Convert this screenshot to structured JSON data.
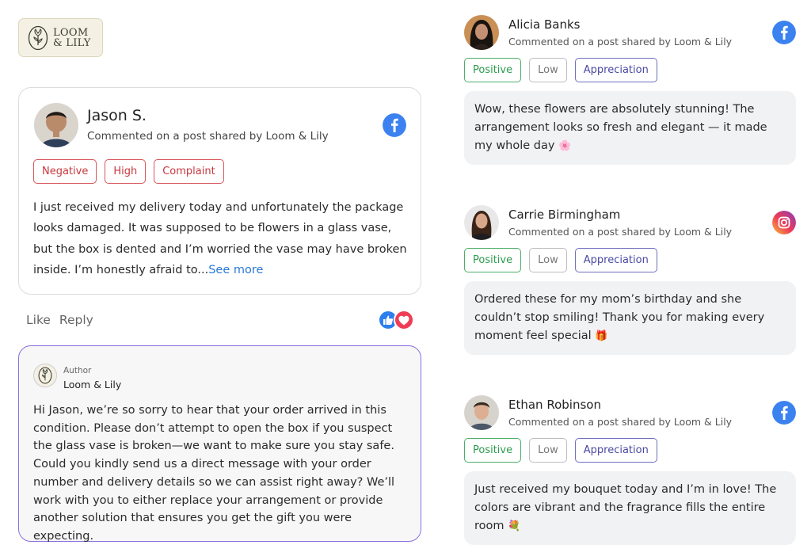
{
  "brand": {
    "line1": "LOOM",
    "line2": "& LILY"
  },
  "main_comment": {
    "author": "Jason S.",
    "subtitle": "Commented on a post shared by Loom & Lily",
    "network_icon": "facebook-icon",
    "tags": [
      "Negative",
      "High",
      "Complaint"
    ],
    "body": "I just received my delivery today and unfortunately the package looks damaged. It was supposed to be flowers in a glass vase, but the box is dented and I’m worried the vase may have broken inside. I’m honestly afraid to...",
    "see_more": "See more"
  },
  "actions": {
    "like": "Like",
    "reply": "Reply"
  },
  "reply": {
    "role": "Author",
    "name": "Loom & Lily",
    "body": "Hi Jason, we’re so sorry to hear that your order arrived in this condition. Please don’t attempt to open the box if you suspect the glass vase is broken—we want to make sure you stay safe. Could you kindly send us a direct message with your order number and delivery details so we can assist right away? We’ll work with you to either replace your arrangement or provide another solution that ensures you get the gift you were expecting."
  },
  "comments": [
    {
      "name": "Alicia Banks",
      "subtitle": "Commented on a post shared by Loom & Lily",
      "network_icon": "facebook-icon",
      "tags": [
        "Positive",
        "Low",
        "Appreciation"
      ],
      "body": "Wow, these flowers are absolutely stunning! The arrangement looks so fresh and elegant — it made my whole day",
      "emoji": "🌸"
    },
    {
      "name": "Carrie Birmingham",
      "subtitle": "Commented on a post shared by Loom & Lily",
      "network_icon": "instagram-icon",
      "tags": [
        "Positive",
        "Low",
        "Appreciation"
      ],
      "body": "Ordered these for my mom’s birthday and she couldn’t stop smiling! Thank you for making every moment feel special",
      "emoji": "🎁"
    },
    {
      "name": "Ethan Robinson",
      "subtitle": "Commented on a post shared by Loom & Lily",
      "network_icon": "facebook-icon",
      "tags": [
        "Positive",
        "Low",
        "Appreciation"
      ],
      "body": "Just received my bouquet today and I’m in love! The colors are vibrant and the fragrance fills the entire room",
      "emoji": "💐"
    }
  ],
  "colors": {
    "facebook": "#3b82f0",
    "negative": "#c8383e",
    "positive": "#2d9b4d",
    "appreciation": "#4a4aa3",
    "reply_border": "#8a6fe0"
  }
}
